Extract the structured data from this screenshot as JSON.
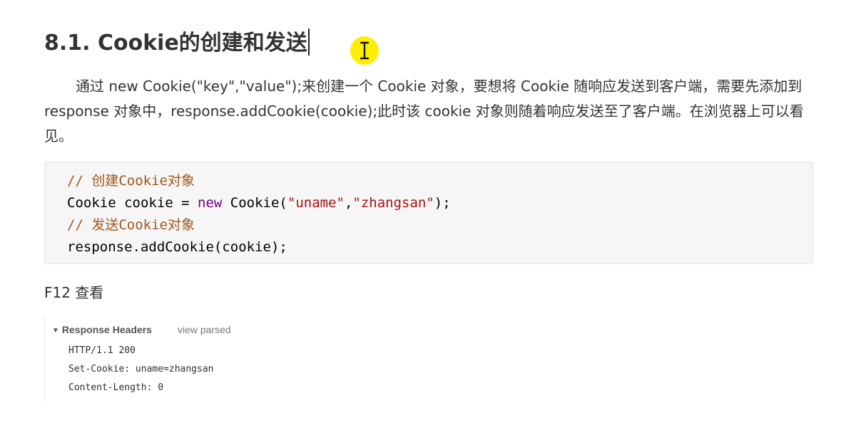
{
  "heading": "8.1. Cookie的创建和发送",
  "paragraph": "通过 new Cookie(\"key\",\"value\");来创建一个 Cookie 对象，要想将 Cookie 随响应发送到客户端，需要先添加到 response 对象中，response.addCookie(cookie);此时该 cookie 对象则随着响应发送至了客户端。在浏览器上可以看见。",
  "code": {
    "comment1": "// 创建Cookie对象",
    "line2_a": "Cookie cookie = ",
    "line2_kw": "new",
    "line2_b": " Cookie(",
    "line2_s1": "\"uname\"",
    "line2_c": ",",
    "line2_s2": "\"zhangsan\"",
    "line2_d": ");",
    "comment2": "// 发送Cookie对象",
    "line4": "response.addCookie(cookie);"
  },
  "f12_label": "F12 查看",
  "devtools": {
    "section_title": "Response Headers",
    "view_parsed": "view parsed",
    "lines": [
      "HTTP/1.1 200",
      "Set-Cookie: uname=zhangsan",
      "Content-Length: 0"
    ]
  },
  "icons": {
    "disclosure": "triangle-down-icon",
    "cursor": "ibeam-cursor-icon"
  },
  "colors": {
    "comment": "#a0581e",
    "keyword": "#770088",
    "string": "#aa1111",
    "cursor_highlight": "#ffee00"
  }
}
